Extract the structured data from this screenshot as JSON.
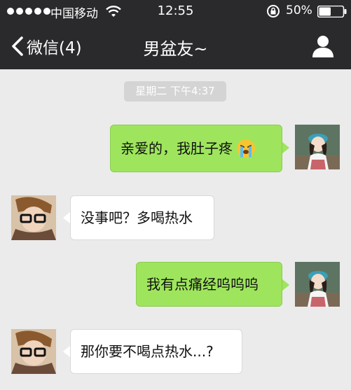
{
  "status_bar": {
    "carrier": "中国移动",
    "time": "12:55",
    "battery": "50%",
    "battery_level": 0.5
  },
  "nav": {
    "back_label": "微信(4)",
    "title": "男盆友~"
  },
  "timestamp": "星期二 下午4:37",
  "messages": [
    {
      "side": "right",
      "text": "亲爱的，我肚子疼",
      "emoji": "crying-face-icon"
    },
    {
      "side": "left",
      "text": "没事吧？多喝热水"
    },
    {
      "side": "right",
      "text": "我有点痛经呜呜呜"
    },
    {
      "side": "left",
      "text": "那你要不喝点热水...?"
    }
  ],
  "colors": {
    "nav_background": "#2a2a2d",
    "chat_background": "#ebebeb",
    "sent_bubble": "#9ee55d",
    "received_bubble": "#ffffff"
  }
}
